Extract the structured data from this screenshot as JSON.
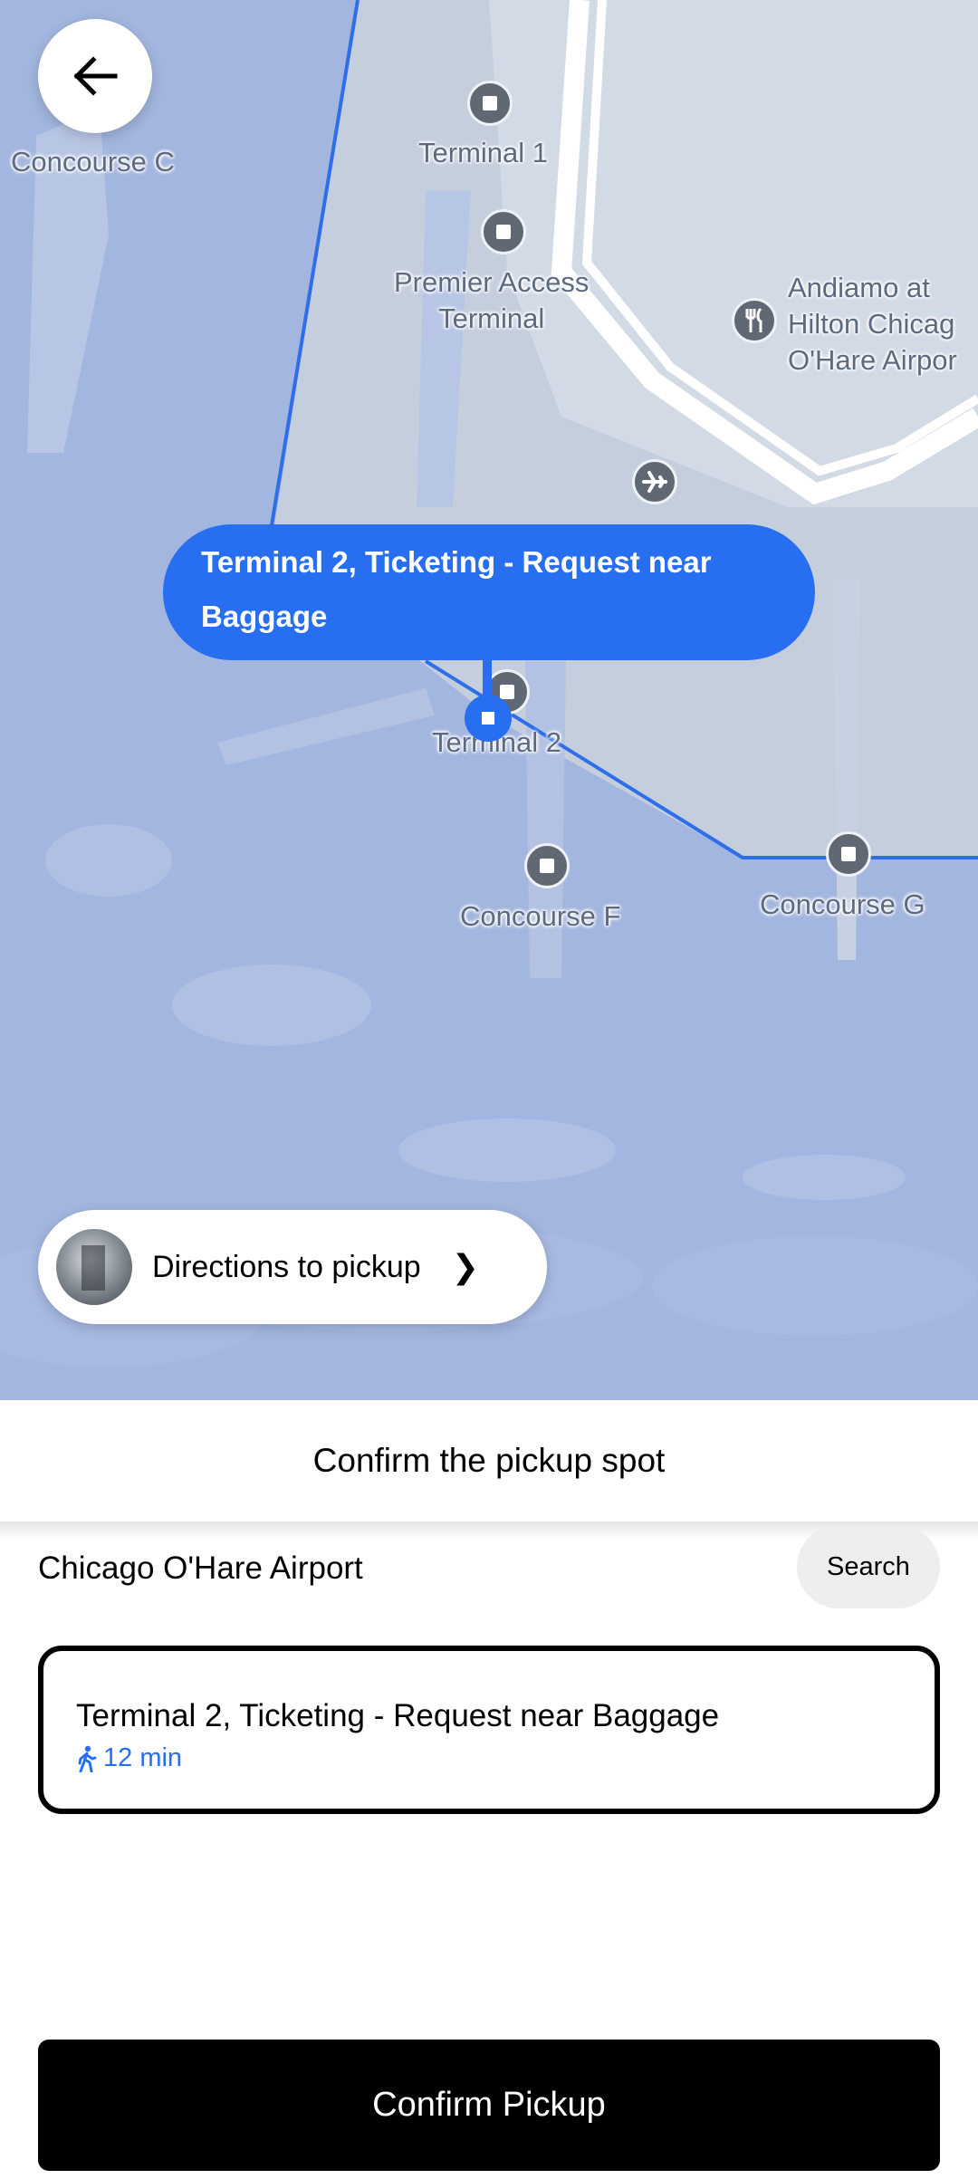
{
  "map": {
    "labels": {
      "concourse_c": "Concourse C",
      "terminal_1": "Terminal 1",
      "premier_access": "Premier Access\nTerminal",
      "andiamo": "Andiamo at\nHilton Chicag\nO'Hare Airpor",
      "terminal_2": "Terminal 2",
      "concourse_f": "Concourse F",
      "concourse_g": "Concourse G"
    },
    "pickup_bubble": "Terminal 2, Ticketing - Request near Baggage",
    "directions_button": "Directions to pickup"
  },
  "sheet": {
    "title": "Confirm the pickup spot",
    "location_name": "Chicago O'Hare Airport",
    "search_label": "Search",
    "selected_spot": {
      "title": "Terminal 2, Ticketing - Request near Baggage",
      "walk_time": "12 min"
    },
    "confirm_label": "Confirm Pickup"
  },
  "colors": {
    "accent": "#276ef1",
    "water": "#a3b6df",
    "land": "#c9d2e0",
    "button": "#000000"
  }
}
